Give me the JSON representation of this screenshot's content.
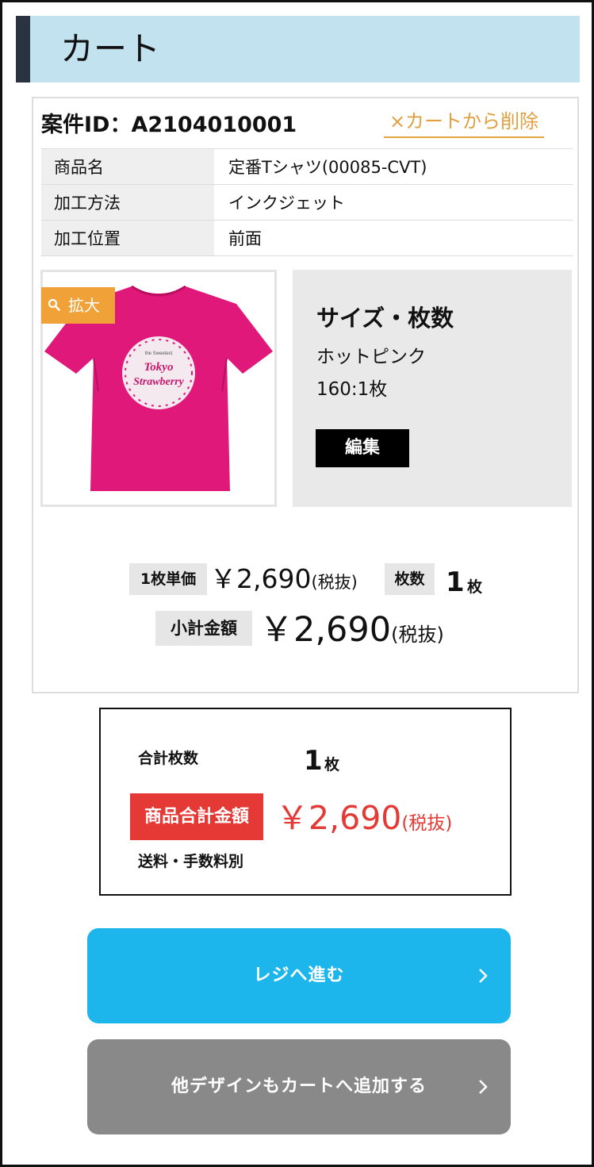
{
  "header": {
    "title": "カート"
  },
  "item": {
    "case_id": "案件ID：A2104010001",
    "remove_label": "×カートから削除",
    "specs": [
      {
        "label": "商品名",
        "value": "定番Tシャツ(00085-CVT)"
      },
      {
        "label": "加工方法",
        "value": "インクジェット"
      },
      {
        "label": "加工位置",
        "value": "前面"
      }
    ],
    "image": {
      "shirt_color": "#e0187a",
      "print_text_1": "Tokyo",
      "print_text_2": "Strawberry",
      "print_text_small": "the Sweetest",
      "zoom_icon": "search-icon",
      "zoom_label": "拡大"
    },
    "size_panel": {
      "heading": "サイズ・枚数",
      "color": "ホットピンク",
      "quantity": "160:1枚",
      "edit_label": "編集"
    },
    "unit_price_label": "1枚単価",
    "unit_price": "￥2,690",
    "tax_note": "(税抜)",
    "qty_label": "枚数",
    "qty_value": "1",
    "qty_unit": "枚",
    "subtotal_label": "小計金額",
    "subtotal": "￥2,690"
  },
  "summary": {
    "total_qty_label": "合計枚数",
    "total_qty_value": "1",
    "total_qty_unit": "枚",
    "total_amount_label": "商品合計金額",
    "total_amount": "￥2,690",
    "tax_note": "(税抜)",
    "shipping_note": "送料・手数料別"
  },
  "buttons": {
    "checkout_label": "レジへ進む",
    "add_design_label": "他デザインもカートへ追加する",
    "arrow_icon": "chevron-right-icon"
  },
  "colors": {
    "header_bg": "#c1e2ee",
    "accent_orange": "#e0a040",
    "total_red": "#e53935",
    "checkout_blue": "#1db6ec",
    "secondary_gray": "#898989"
  }
}
